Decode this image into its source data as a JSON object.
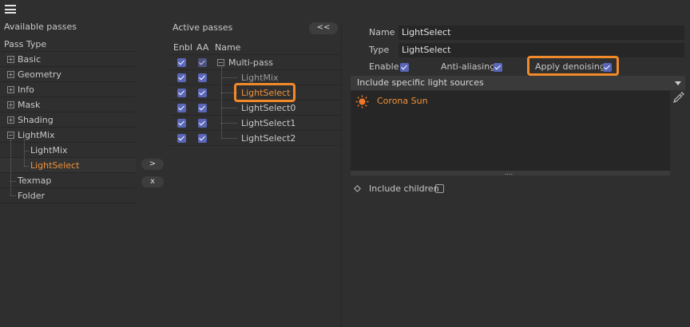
{
  "left_panel": {
    "title": "Available passes",
    "column_header": "Pass Type",
    "items": [
      {
        "label": "Basic",
        "expanded": false
      },
      {
        "label": "Geometry",
        "expanded": false
      },
      {
        "label": "Info",
        "expanded": false
      },
      {
        "label": "Mask",
        "expanded": false
      },
      {
        "label": "Shading",
        "expanded": false
      },
      {
        "label": "LightMix",
        "expanded": true
      },
      {
        "label": "LightMix",
        "child": true
      },
      {
        "label": "LightSelect",
        "child": true,
        "selected": true
      },
      {
        "label": "Texmap"
      },
      {
        "label": "Folder"
      }
    ]
  },
  "transfer_buttons": {
    "add_label": ">",
    "remove_label": "x"
  },
  "active_panel": {
    "title": "Active passes",
    "collapse_label": "<<",
    "columns": [
      "Enbl",
      "AA",
      "Name"
    ],
    "root": "Multi-pass",
    "rows": [
      {
        "name": "LightMix",
        "enabled": true,
        "aa": true,
        "dim": true
      },
      {
        "name": "LightSelect",
        "enabled": true,
        "aa": true,
        "selected": true
      },
      {
        "name": "LightSelect0",
        "enabled": true,
        "aa": true
      },
      {
        "name": "LightSelect1",
        "enabled": true,
        "aa": true
      },
      {
        "name": "LightSelect2",
        "enabled": true,
        "aa": true
      }
    ]
  },
  "properties": {
    "name_label": "Name",
    "name_value": "LightSelect",
    "type_label": "Type",
    "type_value": "LightSelect",
    "enable_label": "Enable",
    "antialias_label": "Anti-aliasing",
    "denoise_label": "Apply denoising",
    "lights_dropdown": "Include specific light sources",
    "lights": [
      {
        "name": "Corona Sun",
        "icon": "sun-icon"
      }
    ],
    "include_children_label": "Include children",
    "include_children": false
  },
  "colors": {
    "accent_orange": "#f0892a",
    "checkbox_blue": "#5a66b8",
    "background": "#2f2f2f"
  }
}
